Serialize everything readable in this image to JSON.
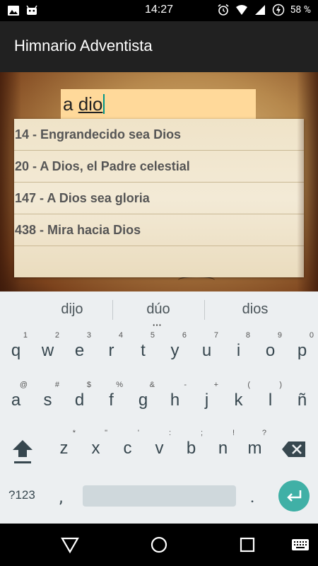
{
  "status_bar": {
    "time": "14:27",
    "battery": "58 %",
    "left_icons": [
      "image-icon",
      "android-debug-icon"
    ],
    "right_icons": [
      "alarm-icon",
      "wifi-icon",
      "signal-icon",
      "battery-charging-icon"
    ]
  },
  "app_bar": {
    "title": "Himnario Adventista"
  },
  "search": {
    "prefix": "a ",
    "composing": "dio"
  },
  "results": [
    "14 - Engrandecido sea Dios",
    "20 - A Dios, el Padre celestial",
    "147 - A Dios sea gloria",
    "438 - Mira hacia Dios"
  ],
  "keyboard": {
    "suggestions": [
      "dijo",
      "dúo",
      "dios"
    ],
    "row1": [
      {
        "key": "q",
        "hint": "1"
      },
      {
        "key": "w",
        "hint": "2"
      },
      {
        "key": "e",
        "hint": "3"
      },
      {
        "key": "r",
        "hint": "4"
      },
      {
        "key": "t",
        "hint": "5"
      },
      {
        "key": "y",
        "hint": "6"
      },
      {
        "key": "u",
        "hint": "7"
      },
      {
        "key": "i",
        "hint": "8"
      },
      {
        "key": "o",
        "hint": "9"
      },
      {
        "key": "p",
        "hint": "0"
      }
    ],
    "row2": [
      {
        "key": "a",
        "hint": "@"
      },
      {
        "key": "s",
        "hint": "#"
      },
      {
        "key": "d",
        "hint": "$"
      },
      {
        "key": "f",
        "hint": "%"
      },
      {
        "key": "g",
        "hint": "&"
      },
      {
        "key": "h",
        "hint": "-"
      },
      {
        "key": "j",
        "hint": "+"
      },
      {
        "key": "k",
        "hint": "("
      },
      {
        "key": "l",
        "hint": ")"
      },
      {
        "key": "ñ",
        "hint": ""
      }
    ],
    "row3": [
      {
        "key": "z",
        "hint": "*"
      },
      {
        "key": "x",
        "hint": "\""
      },
      {
        "key": "c",
        "hint": "'"
      },
      {
        "key": "v",
        "hint": ":"
      },
      {
        "key": "b",
        "hint": ";"
      },
      {
        "key": "n",
        "hint": "!"
      },
      {
        "key": "m",
        "hint": "?"
      }
    ],
    "symbols_label": "?123",
    "comma": ",",
    "period": "."
  },
  "nav_bar": {
    "buttons": [
      "back-icon",
      "home-icon",
      "recents-icon",
      "keyboard-switch-icon"
    ]
  },
  "colors": {
    "app_bar": "#212121",
    "search_field": "#ffd99a",
    "caret": "#009688",
    "enter_key": "#40b0a6",
    "keyboard_bg": "#eceff1"
  }
}
